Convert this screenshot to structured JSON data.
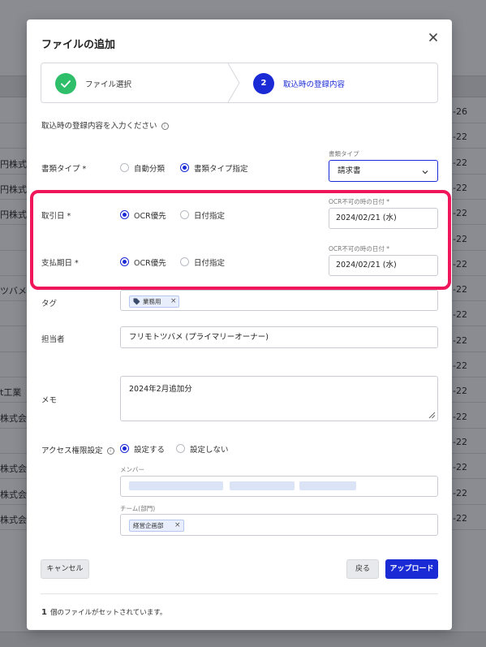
{
  "background": {
    "left_fragments": [
      "",
      "",
      "円株式会",
      "円株式会",
      "円株式会",
      "",
      "",
      "ツバメ",
      "",
      "",
      "",
      "t工業",
      "株式会",
      "",
      "株式会",
      "株式会",
      "株式会"
    ],
    "right_fragments": [
      "-26",
      "-22",
      "-22",
      "-22",
      "-22",
      "-22",
      "-22",
      "-22",
      "-22",
      "-22",
      "-22",
      "-22",
      "-22",
      "-22",
      "-22",
      "-22",
      "-22"
    ]
  },
  "modal": {
    "title": "ファイルの追加",
    "steps": [
      {
        "number": "",
        "label": "ファイル選択",
        "state": "done"
      },
      {
        "number": "2",
        "label": "取込時の登録内容",
        "state": "active"
      }
    ],
    "instruction": "取込時の登録内容を入力ください",
    "doc_type": {
      "label": "書類タイプ *",
      "options": [
        "自動分類",
        "書類タイプ指定"
      ],
      "selected": "書類タイプ指定",
      "select_caption": "書類タイプ",
      "select_value": "請求書"
    },
    "transaction_date": {
      "label": "取引日 *",
      "options": [
        "OCR優先",
        "日付指定"
      ],
      "selected": "OCR優先",
      "caption": "OCR不可の時の日付 *",
      "value": "2024/02/21 (水)"
    },
    "payment_date": {
      "label": "支払期日 *",
      "options": [
        "OCR優先",
        "日付指定"
      ],
      "selected": "OCR優先",
      "caption": "OCR不可の時の日付 *",
      "value": "2024/02/21 (水)"
    },
    "tag": {
      "label": "タグ",
      "chips": [
        "業務用"
      ]
    },
    "owner": {
      "label": "担当者",
      "value": "フリモトツバメ (プライマリーオーナー)"
    },
    "memo": {
      "label": "メモ",
      "value": "2024年2月追加分"
    },
    "access": {
      "label": "アクセス権限設定",
      "options": [
        "設定する",
        "設定しない"
      ],
      "selected": "設定する",
      "members_caption": "メンバー",
      "team_caption": "チーム(部門)",
      "team_chips": [
        "経営企画部"
      ]
    },
    "buttons": {
      "cancel": "キャンセル",
      "back": "戻る",
      "upload": "アップロード"
    },
    "footer": {
      "count": "1",
      "text": "個のファイルがセットされています。"
    }
  },
  "colors": {
    "primary": "#1a2bd6",
    "success": "#2fbe6a",
    "highlight": "#f0165c"
  }
}
